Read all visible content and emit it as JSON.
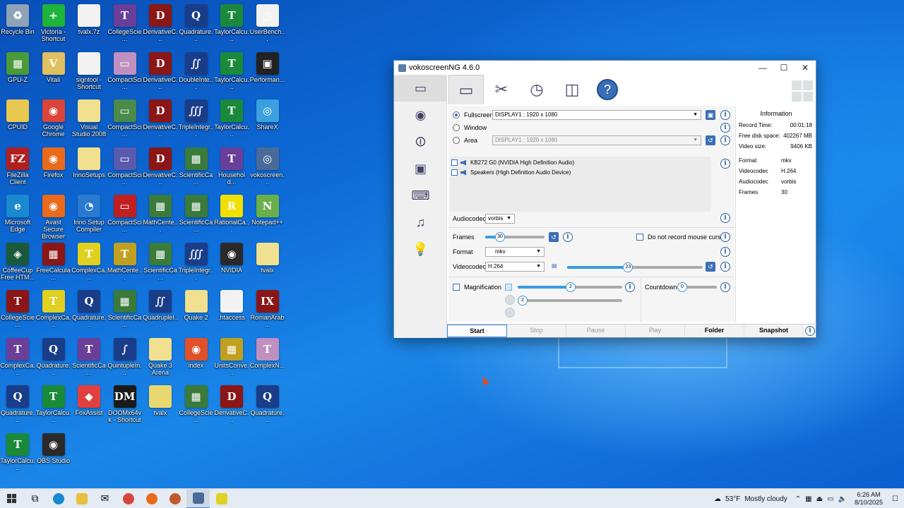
{
  "desktop": {
    "icons": [
      {
        "label": "Recycle Bin",
        "color": "#8fa3b8",
        "glyph": "♻"
      },
      {
        "label": "Victoria - Shortcut",
        "color": "#1eb33a",
        "glyph": "+"
      },
      {
        "label": "tvalx.7z",
        "color": "#f2f2f2",
        "glyph": ""
      },
      {
        "label": "CollegeScie...",
        "color": "#6a3f9a",
        "glyph": "T"
      },
      {
        "label": "DerivativeC...",
        "color": "#8a1616",
        "glyph": "D"
      },
      {
        "label": "Quadrature...",
        "color": "#1a3d8a",
        "glyph": "Q"
      },
      {
        "label": "TaylorCalcu...",
        "color": "#1a8a3a",
        "glyph": "T"
      },
      {
        "label": "UserBench...",
        "color": "#f2f2f2",
        "glyph": "◷"
      },
      {
        "label": "GPU-Z",
        "color": "#4a9a3a",
        "glyph": "▦"
      },
      {
        "label": "Vitali",
        "color": "#e0c060",
        "glyph": "V"
      },
      {
        "label": "signtool - Shortcut",
        "color": "#f2f2f2",
        "glyph": ""
      },
      {
        "label": "CompactSci...",
        "color": "#c090c0",
        "glyph": "▭"
      },
      {
        "label": "DerivativeC...",
        "color": "#8a1616",
        "glyph": "D"
      },
      {
        "label": "DoubleInte...",
        "color": "#1a3d8a",
        "glyph": "∬"
      },
      {
        "label": "TaylorCalcu...",
        "color": "#1a8a3a",
        "glyph": "T"
      },
      {
        "label": "Performan...",
        "color": "#222222",
        "glyph": "▣"
      },
      {
        "label": "CPUID",
        "color": "#e8c850",
        "glyph": ""
      },
      {
        "label": "Google Chrome",
        "color": "#d9453b",
        "glyph": "◉"
      },
      {
        "label": "Visual Studio 2008",
        "color": "#f0e090",
        "glyph": ""
      },
      {
        "label": "CompactSci...",
        "color": "#4a8a4a",
        "glyph": "▭"
      },
      {
        "label": "DerivativeC...",
        "color": "#8a1616",
        "glyph": "D"
      },
      {
        "label": "TripleIntegr...",
        "color": "#1a3d8a",
        "glyph": "∭"
      },
      {
        "label": "TaylorCalcu...",
        "color": "#1a8a3a",
        "glyph": "T"
      },
      {
        "label": "ShareX",
        "color": "#3aa0e0",
        "glyph": "◎"
      },
      {
        "label": "FileZilla Client",
        "color": "#b02020",
        "glyph": "FZ"
      },
      {
        "label": "Firefox",
        "color": "#e86a1a",
        "glyph": "◉"
      },
      {
        "label": "InnoSetups",
        "color": "#f0e090",
        "glyph": ""
      },
      {
        "label": "CompactSci...",
        "color": "#5a5ab0",
        "glyph": "▭"
      },
      {
        "label": "DerivativeC...",
        "color": "#8a1616",
        "glyph": "D"
      },
      {
        "label": "ScientificCa...",
        "color": "#3a7a3a",
        "glyph": "▦"
      },
      {
        "label": "Househol​d...",
        "color": "#6a3f9a",
        "glyph": "T"
      },
      {
        "label": "vokoscreen...",
        "color": "#4a6a9a",
        "glyph": "◎"
      },
      {
        "label": "Microsoft Edge",
        "color": "#1a8ad0",
        "glyph": "e"
      },
      {
        "label": "Avast Secure Browser",
        "color": "#e86a1a",
        "glyph": "◉"
      },
      {
        "label": "Inno Setup Compiler",
        "color": "#2a7ad0",
        "glyph": "◔"
      },
      {
        "label": "CompactSci...",
        "color": "#c02020",
        "glyph": "▭"
      },
      {
        "label": "MathCente...",
        "color": "#3a7a3a",
        "glyph": "▦"
      },
      {
        "label": "ScientificCa...",
        "color": "#3a7a3a",
        "glyph": "▦"
      },
      {
        "label": "RationalCa...",
        "color": "#f0e000",
        "glyph": "R"
      },
      {
        "label": "Notepad++",
        "color": "#6ab04a",
        "glyph": "N"
      },
      {
        "label": "CoffeeCup Free HTM...",
        "color": "#1a5a3a",
        "glyph": "◈"
      },
      {
        "label": "FreeCalcula...",
        "color": "#8a1616",
        "glyph": "▦"
      },
      {
        "label": "ComplexCa...",
        "color": "#e0d020",
        "glyph": "T"
      },
      {
        "label": "MathCente...",
        "color": "#c0a020",
        "glyph": "T"
      },
      {
        "label": "ScientificCa...",
        "color": "#3a7a3a",
        "glyph": "▦"
      },
      {
        "label": "TripleIntegr...",
        "color": "#1a3d8a",
        "glyph": "∭"
      },
      {
        "label": "NVIDIA",
        "color": "#2a2a2a",
        "glyph": "◉"
      },
      {
        "label": "tvalx",
        "color": "#f0e090",
        "glyph": ""
      },
      {
        "label": "CollegeScie...",
        "color": "#8a1616",
        "glyph": "T"
      },
      {
        "label": "ComplexCa...",
        "color": "#e0d020",
        "glyph": "T"
      },
      {
        "label": "Quadrature...",
        "color": "#1a3d8a",
        "glyph": "Q"
      },
      {
        "label": "ScientificCa...",
        "color": "#3a7a3a",
        "glyph": "▦"
      },
      {
        "label": "QuadrupleI...",
        "color": "#1a3d8a",
        "glyph": "∬"
      },
      {
        "label": "Quake 2",
        "color": "#f0e090",
        "glyph": ""
      },
      {
        "label": ".htaccess",
        "color": "#f2f2f2",
        "glyph": ""
      },
      {
        "label": "RomanArab...",
        "color": "#8a1616",
        "glyph": "IX"
      },
      {
        "label": "ComplexCa...",
        "color": "#6a3f9a",
        "glyph": "T"
      },
      {
        "label": "Quadrature...",
        "color": "#1a3d8a",
        "glyph": "Q"
      },
      {
        "label": "ScientificCa...",
        "color": "#6a3f9a",
        "glyph": "T"
      },
      {
        "label": "QuintupleIn...",
        "color": "#1a3d8a",
        "glyph": "∫"
      },
      {
        "label": "Quake 3 Arena",
        "color": "#f0e090",
        "glyph": ""
      },
      {
        "label": "index",
        "color": "#e0502a",
        "glyph": "◉"
      },
      {
        "label": "UnitsConve...",
        "color": "#c0a020",
        "glyph": "▦"
      },
      {
        "label": "ComplexN...",
        "color": "#c090c0",
        "glyph": "T"
      },
      {
        "label": "Quadrature...",
        "color": "#1a3d8a",
        "glyph": "Q"
      },
      {
        "label": "TaylorCalcu...",
        "color": "#1a8a3a",
        "glyph": "T"
      },
      {
        "label": "FoxAssist",
        "color": "#e04040",
        "glyph": "◆"
      },
      {
        "label": "DOOMx64vk - Shortcut",
        "color": "#1a1a1a",
        "glyph": "DM"
      },
      {
        "label": "tvalx",
        "color": "#e8d870",
        "glyph": ""
      },
      {
        "label": "CollegeScie...",
        "color": "#3a7a3a",
        "glyph": "▦"
      },
      {
        "label": "DerivativeC...",
        "color": "#8a1616",
        "glyph": "D"
      },
      {
        "label": "Quadrature...",
        "color": "#1a3d8a",
        "glyph": "Q"
      },
      {
        "label": "TaylorCalcu...",
        "color": "#1a8a3a",
        "glyph": "T"
      },
      {
        "label": "OBS Studio",
        "color": "#2a2a2a",
        "glyph": "◉"
      }
    ]
  },
  "app": {
    "title": "vokoscreenNG 4.6.0",
    "capture": {
      "fullscreen_label": "Fullscreen",
      "fullscreen_value": "DISPLAY1 : 1920 x 1080",
      "window_label": "Window",
      "area_label": "Area",
      "area_value": "DISPLAY1 : 1920 x 1080"
    },
    "audio": {
      "devices": [
        "KB272 G0 (NVIDIA High Definition Audio)",
        "Speakers (High Definition Audio Device)"
      ],
      "audiocodec_label": "Audiocodec",
      "audiocodec_value": "vorbis"
    },
    "video": {
      "frames_label": "Frames",
      "frames_value": "30",
      "no_mouse_label": "Do not record mouse cursor",
      "format_label": "Format",
      "format_value": "mkv",
      "videocodec_label": "Videocodec",
      "videocodec_value": "H.264",
      "quality_value": "23",
      "quality_fraction": 0.45,
      "frames_fraction": 0.25
    },
    "extras": {
      "magnification_label": "Magnification",
      "magnification_value": "2",
      "magnification_level2": "2",
      "countdown_label": "Countdown",
      "countdown_value": "0"
    },
    "info": {
      "title": "Information",
      "rows": [
        {
          "k": "Record Time:",
          "v": "00:01:18"
        },
        {
          "k": "Free disk space:",
          "v": "402267 MB"
        },
        {
          "k": "Video size:",
          "v": "9406 KB"
        },
        {
          "k": "Format",
          "v": "mkv"
        },
        {
          "k": "Videocodec",
          "v": "H.264"
        },
        {
          "k": "Audiocodec",
          "v": "vorbis"
        },
        {
          "k": "Frames",
          "v": "30"
        }
      ]
    },
    "buttons": {
      "start": "Start",
      "stop": "Stop",
      "pause": "Pause",
      "play": "Play",
      "folder": "Folder",
      "snapshot": "Snapshot"
    }
  },
  "taskbar": {
    "weather": "53°F",
    "weather_desc": "Mostly cloudy",
    "time": "6:26 AM",
    "date": "8/10/2025"
  }
}
